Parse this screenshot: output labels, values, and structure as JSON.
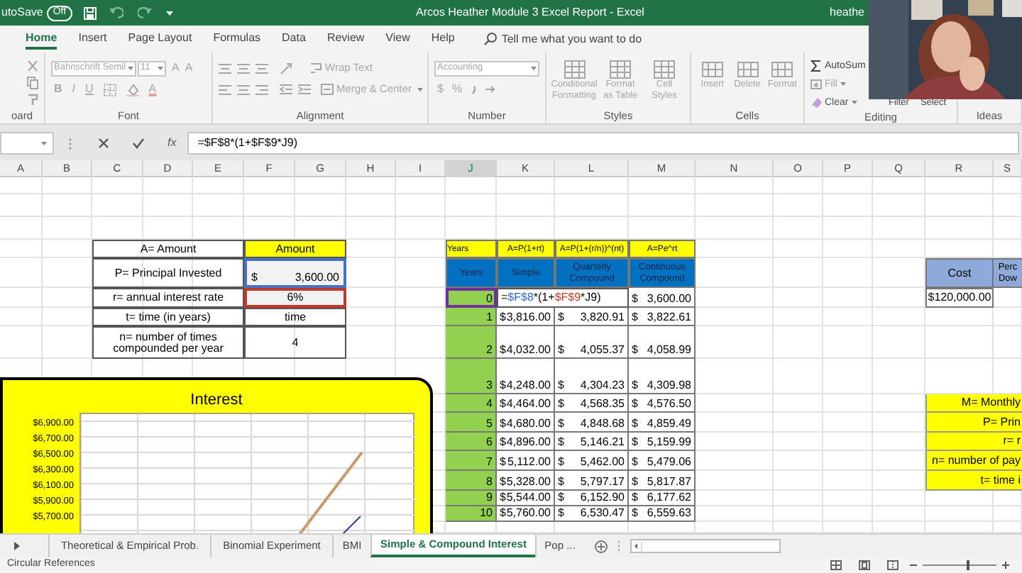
{
  "title_bar": {
    "autosave_label": "utoSave",
    "autosave": {
      "label": "Off",
      "on": false
    },
    "title": "Arcos Heather Module 3 Excel Report  -  Excel",
    "user": "heathe"
  },
  "ribbon_tabs": [
    {
      "label": "Home",
      "selected": true
    },
    {
      "label": "Insert",
      "selected": false
    },
    {
      "label": "Page Layout",
      "selected": false
    },
    {
      "label": "Formulas",
      "selected": false
    },
    {
      "label": "Data",
      "selected": false
    },
    {
      "label": "Review",
      "selected": false
    },
    {
      "label": "View",
      "selected": false
    },
    {
      "label": "Help",
      "selected": false
    }
  ],
  "tell_me": "Tell me what you want to do",
  "ribbon": {
    "disabled": true,
    "groups": [
      "oard",
      "Font",
      "Alignment",
      "Number",
      "Styles",
      "Cells",
      "Editing",
      "Ideas"
    ],
    "font_name": "Bahnschrift Semil",
    "font_size": "11",
    "size_buttons": [
      "A",
      "A"
    ],
    "font_styles": [
      "B",
      "I",
      "U"
    ],
    "font_color": "A",
    "wrap_text": "Wrap Text",
    "merge": "Merge & Center",
    "number_format": "Accounting",
    "number_buttons": [
      "$",
      "%"
    ],
    "styles": [
      "Conditional Formatting",
      "Format as Table",
      "Cell Styles"
    ],
    "cells": [
      "Insert",
      "Delete",
      "Format"
    ],
    "editing": [
      "AutoSum",
      "Fill",
      "Clear"
    ],
    "editing_more": [
      "Filter",
      "Select"
    ]
  },
  "formula_bar": {
    "fx": "fx",
    "formula": "=$F$8*(1+$F$9*J9)"
  },
  "columns": [
    "A",
    "B",
    "C",
    "D",
    "E",
    "F",
    "G",
    "H",
    "I",
    "J",
    "K",
    "L",
    "M",
    "N",
    "O",
    "P",
    "Q",
    "R",
    "S"
  ],
  "inputs_table": {
    "header": {
      "label": "A= Amount",
      "value": "Amount"
    },
    "rows": [
      {
        "label": "P= Principal Invested",
        "currency": "$",
        "value": "3,600.00",
        "color": "#4472c4"
      },
      {
        "label": "r= annual interest rate",
        "value": "6%",
        "color": "#c0392b"
      },
      {
        "label": "t= time (in years)",
        "value": "time"
      },
      {
        "label": "n= number of times compounded per year",
        "value": "4"
      }
    ]
  },
  "growth_table": {
    "formulas": [
      "Years",
      "A=P(1+rt)",
      "A=P(1+(r/n))^(nt)",
      "A=Pe^rt"
    ],
    "headers": [
      "Years",
      "Simple",
      "Quarterly Compound",
      "Continuous Compound"
    ],
    "rows": [
      {
        "year": "0",
        "selected": true,
        "editing_formula": [
          {
            "text": "="
          },
          {
            "text": "$F$8",
            "color": "#3366cc"
          },
          {
            "text": "*(1+"
          },
          {
            "text": "$F$9",
            "color": "#c0392b"
          },
          {
            "text": "*J9)"
          }
        ],
        "continuous": [
          "$",
          "3,600.00"
        ]
      },
      {
        "year": "1",
        "selected": false,
        "simple": [
          "$",
          "3,816.00"
        ],
        "quarterly": [
          "$",
          "3,820.91"
        ],
        "continuous": [
          "$",
          "3,822.61"
        ]
      },
      {
        "year": "2",
        "selected": false,
        "simple": [
          "$",
          "4,032.00"
        ],
        "quarterly": [
          "$",
          "4,055.37"
        ],
        "continuous": [
          "$",
          "4,058.99"
        ]
      },
      {
        "year": "3",
        "selected": false,
        "simple": [
          "$",
          "4,248.00"
        ],
        "quarterly": [
          "$",
          "4,304.23"
        ],
        "continuous": [
          "$",
          "4,309.98"
        ]
      },
      {
        "year": "4",
        "selected": false,
        "simple": [
          "$",
          "4,464.00"
        ],
        "quarterly": [
          "$",
          "4,568.35"
        ],
        "continuous": [
          "$",
          "4,576.50"
        ]
      },
      {
        "year": "5",
        "selected": false,
        "simple": [
          "$",
          "4,680.00"
        ],
        "quarterly": [
          "$",
          "4,848.68"
        ],
        "continuous": [
          "$",
          "4,859.49"
        ]
      },
      {
        "year": "6",
        "selected": false,
        "simple": [
          "$",
          "4,896.00"
        ],
        "quarterly": [
          "$",
          "5,146.21"
        ],
        "continuous": [
          "$",
          "5,159.99"
        ]
      },
      {
        "year": "7",
        "selected": false,
        "simple": [
          "$",
          "5,112.00"
        ],
        "quarterly": [
          "$",
          "5,462.00"
        ],
        "continuous": [
          "$",
          "5,479.06"
        ]
      },
      {
        "year": "8",
        "selected": false,
        "simple": [
          "$",
          "5,328.00"
        ],
        "quarterly": [
          "$",
          "5,797.17"
        ],
        "continuous": [
          "$",
          "5,817.87"
        ]
      },
      {
        "year": "9",
        "selected": false,
        "simple": [
          "$",
          "5,544.00"
        ],
        "quarterly": [
          "$",
          "6,152.90"
        ],
        "continuous": [
          "$",
          "6,177.62"
        ]
      },
      {
        "year": "10",
        "selected": false,
        "simple": [
          "$",
          "5,760.00"
        ],
        "quarterly": [
          "$",
          "6,530.47"
        ],
        "continuous": [
          "$",
          "6,559.63"
        ]
      }
    ]
  },
  "cost_table": {
    "headers": [
      "Cost",
      "Perc Dow"
    ],
    "value": "$120,000.00"
  },
  "loan_box": [
    "M= Monthly",
    "P= Prin",
    "r= r",
    "n= number of pay",
    "t= time i"
  ],
  "chart": {
    "title": "Interest",
    "y_labels": [
      "$6,900.00",
      "$6,700.00",
      "$6,500.00",
      "$6,300.00",
      "$6,100.00",
      "$5,900.00",
      "$5,700.00"
    ]
  },
  "sheet_tabs": [
    {
      "label": "Theoretical & Empirical Prob.",
      "selected": false
    },
    {
      "label": "Binomial Experiment",
      "selected": false
    },
    {
      "label": "BMI",
      "selected": false
    },
    {
      "label": "Simple & Compound Interest",
      "selected": true
    },
    {
      "label": "Pop ...",
      "selected": false
    }
  ],
  "status_bar": {
    "message": "Circular References",
    "zoom": {
      "level": 0.6
    }
  }
}
